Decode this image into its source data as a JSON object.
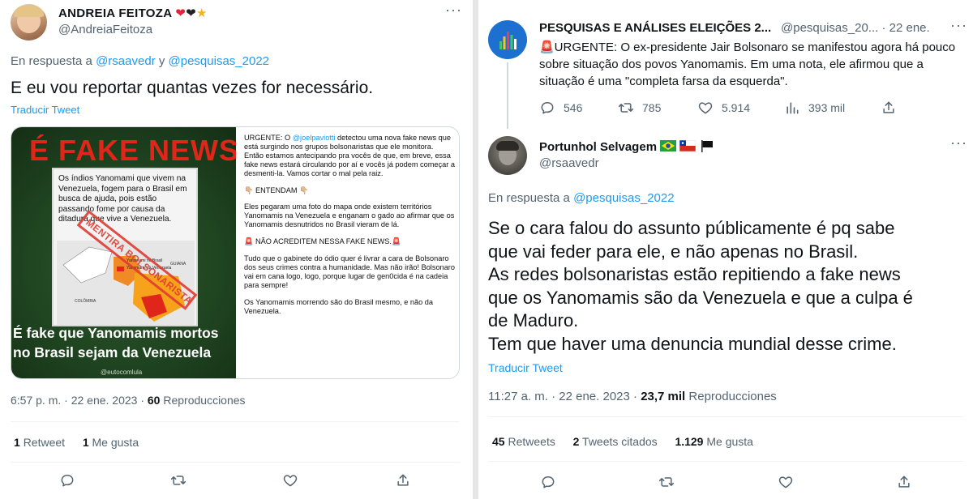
{
  "left": {
    "author": {
      "name": "ANDREIA FEITOZA",
      "handle": "@AndreiaFeitoza"
    },
    "reply_prefix": "En respuesta a",
    "reply_to_1": "@rsaavedr",
    "reply_and": "y",
    "reply_to_2": "@pesquisas_2022",
    "text": "E eu vou reportar quantas vezes for necessário.",
    "translate": "Traducir Tweet",
    "media": {
      "headline": "É FAKE NEWS",
      "card_text": "Os índios Yanomami que vivem na Venezuela, fogem para o Brasil em busca de ajuda, pois estão passando fome por causa da ditadura que vive a Venezuela.",
      "stamp": "MENTIRA BOLSONARISTA",
      "map_labels": [
        "Yanomami no Brasil",
        "Yanomami na Venezuela",
        "COLÔMBIA",
        "GUIANA"
      ],
      "bottom_line_1": "É fake que Yanomamis mortos",
      "bottom_line_2": "no Brasil sejam da Venezuela",
      "watermark": "@eutocomlula",
      "caption": {
        "p1_lead": "URGENTE: O",
        "p1_mention": "@joelpaviotti",
        "p1_rest": "detectou uma nova fake news que está surgindo nos grupos bolsonaristas que ele monitora.",
        "p2": "Então estamos antecipando pra vocês de que, em breve, essa fake news estará circulando por aí e vocês já podem começar a desmenti-la. Vamos cortar o mal pela raiz.",
        "p3": "👇🏼 ENTENDAM 👇🏼",
        "p4": "Eles pegaram uma foto do mapa onde existem territórios Yanomamis na Venezuela e enganam o gado ao afirmar que os Yanomamis desnutridos no Brasil vieram de lá.",
        "p5": "🚨 NÃO ACREDITEM NESSA FAKE NEWS.🚨",
        "p6": "Tudo que o gabinete do ódio quer é livrar a cara de Bolsonaro dos seus crimes contra a humanidade. Mas não irão! Bolsonaro vai em cana logo, logo, porque lugar de gen0cida é na cadeia para sempre!",
        "p7": "Os Yanomamis morrendo são do Brasil mesmo, e não da Venezuela."
      }
    },
    "meta": {
      "time": "6:57 p. m. · 22 ene. 2023 ·",
      "views": "60",
      "views_label": "Reproducciones"
    },
    "stats": {
      "retweets": "1",
      "retweets_label": "Retweet",
      "likes": "1",
      "likes_label": "Me gusta"
    }
  },
  "right": {
    "top": {
      "name": "PESQUISAS E ANÁLISES ELEIÇÕES 2...",
      "handle": "@pesquisas_20...",
      "date": "· 22 ene.",
      "text": "🚨URGENTE: O ex-presidente Jair Bolsonaro se manifestou agora há pouco sobre situação dos povos Yanomamis. Em uma nota, ele afirmou que a situação é uma \"completa farsa da esquerda\".",
      "replies": "546",
      "retweets": "785",
      "likes": "5.914",
      "views": "393 mil"
    },
    "main": {
      "name": "Portunhol Selvagem",
      "handle": "@rsaavedr",
      "reply_prefix": "En respuesta a",
      "reply_to": "@pesquisas_2022",
      "lines": [
        "Se o cara falou do assunto públicamente é pq sabe",
        "que vai feder para ele, e não apenas no Brasil.",
        "As redes bolsonaristas estão repitiendo a fake news",
        "que os Yanomamis são da Venezuela e que a culpa é",
        "de Maduro.",
        "Tem que haver uma denuncia mundial desse crime."
      ],
      "translate": "Traducir Tweet",
      "meta_time": "11:27 a. m. · 22 ene. 2023 ·",
      "views": "23,7 mil",
      "views_label": "Reproducciones",
      "retweets": "45",
      "retweets_label": "Retweets",
      "quotes": "2",
      "quotes_label": "Tweets citados",
      "likes": "1.129",
      "likes_label": "Me gusta"
    }
  },
  "colors": {
    "accent": "#1d9bf0",
    "muted": "#536471",
    "fake_red": "#e0251b"
  }
}
